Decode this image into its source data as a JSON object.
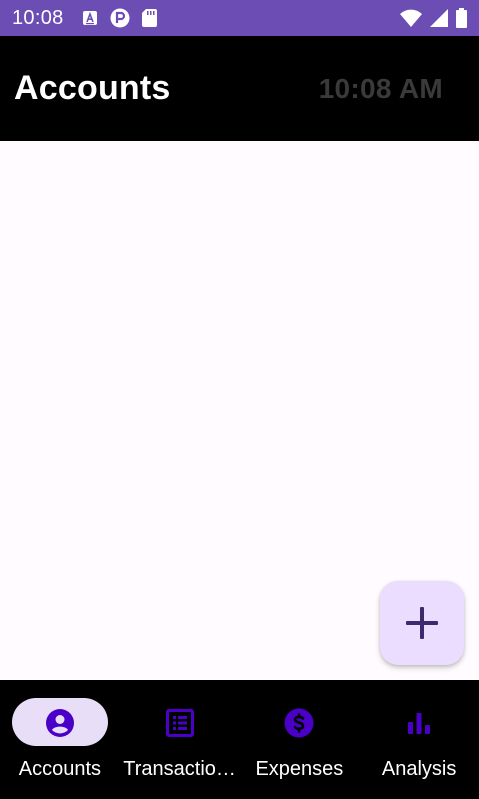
{
  "status_bar": {
    "time": "10:08",
    "left_icons": [
      "a-notification-icon",
      "circle-p-icon",
      "sd-card-icon"
    ],
    "right_icons": [
      "wifi-icon",
      "cell-signal-icon",
      "battery-icon"
    ]
  },
  "app_bar": {
    "title": "Accounts",
    "clock": "10:08 AM"
  },
  "fab": {
    "icon": "plus-icon"
  },
  "bottom_nav": {
    "items": [
      {
        "label": "Accounts",
        "icon": "account-circle-icon",
        "active": true
      },
      {
        "label": "Transactio…",
        "icon": "list-icon",
        "active": false
      },
      {
        "label": "Expenses",
        "icon": "dollar-circle-icon",
        "active": false
      },
      {
        "label": "Analysis",
        "icon": "bar-chart-icon",
        "active": false
      }
    ]
  },
  "colors": {
    "status_bar": "#6c4db3",
    "app_bar": "#000000",
    "background": "#fffbfe",
    "fab": "#eaddff",
    "nav_indicator": "#e8def8",
    "accent": "#4a00c7"
  }
}
